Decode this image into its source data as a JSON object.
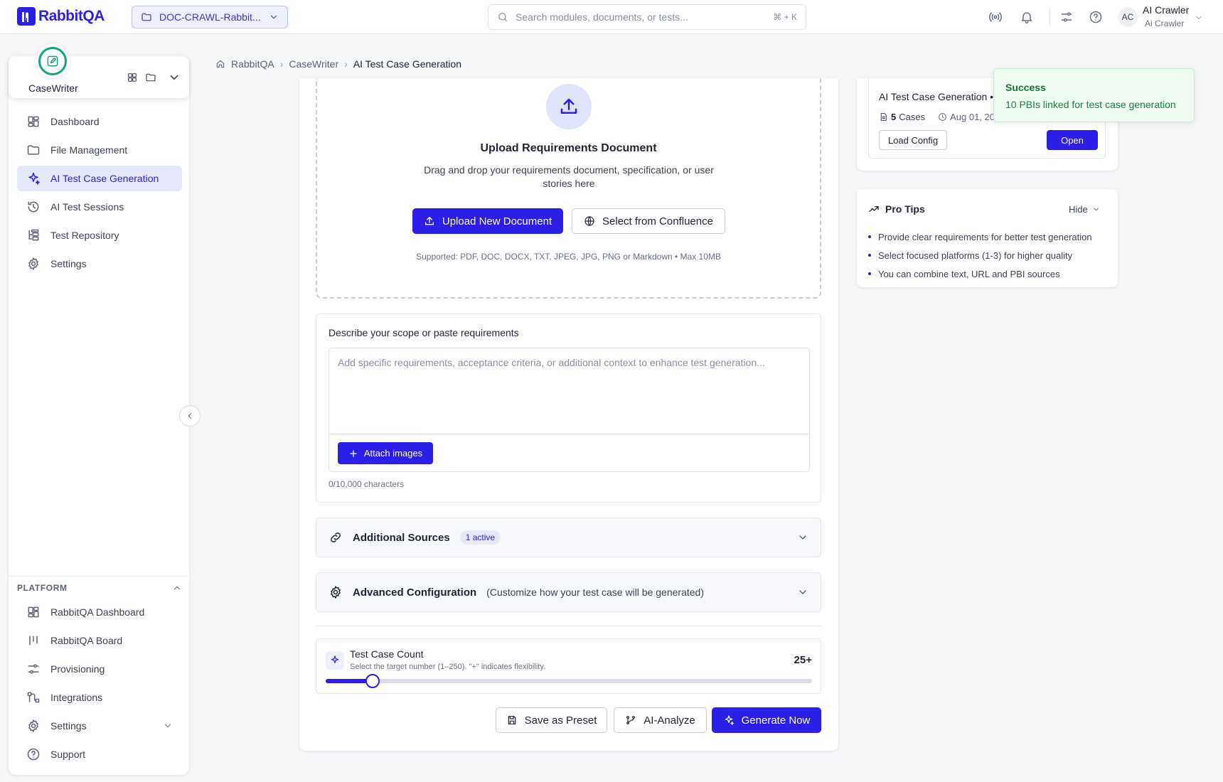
{
  "brand": {
    "name": "RabbitQA",
    "accent": "#2b1ee6",
    "success": "#16733a"
  },
  "header": {
    "project": "DOC-CRAWL-Rabbit...",
    "search_placeholder": "Search modules, documents, or tests...",
    "search_shortcut": "⌘ + K",
    "user_initials": "AC",
    "user_name": "AI Crawler",
    "user_sub": "Ai Crawler"
  },
  "module": {
    "name": "CaseWriter"
  },
  "sidebar": {
    "items": [
      {
        "label": "Dashboard",
        "icon": "grid-icon"
      },
      {
        "label": "File Management",
        "icon": "folder-icon"
      },
      {
        "label": "AI Test Case Generation",
        "icon": "sparkle-icon",
        "active": true
      },
      {
        "label": "AI Test Sessions",
        "icon": "history-icon"
      },
      {
        "label": "Test Repository",
        "icon": "tree-icon"
      },
      {
        "label": "Settings",
        "icon": "gear-icon"
      }
    ],
    "platform_heading": "PLATFORM",
    "platform_items": [
      {
        "label": "RabbitQA Dashboard",
        "icon": "grid-icon"
      },
      {
        "label": "RabbitQA Board",
        "icon": "board-icon"
      },
      {
        "label": "Provisioning",
        "icon": "sliders-icon"
      },
      {
        "label": "Integrations",
        "icon": "integrations-icon"
      },
      {
        "label": "Settings",
        "icon": "gear-icon"
      },
      {
        "label": "Support",
        "icon": "help-icon"
      }
    ]
  },
  "breadcrumb": {
    "home": "RabbitQA",
    "section": "CaseWriter",
    "current": "AI Test Case Generation"
  },
  "upload": {
    "title": "Upload Requirements Document",
    "description": "Drag and drop your requirements document, specification, or user stories here",
    "upload_button": "Upload New Document",
    "confluence_button": "Select from Confluence",
    "supported": "Supported: PDF, DOC, DOCX, TXT, JPEG, JPG, PNG or Markdown • Max 10MB"
  },
  "scope": {
    "label": "Describe your scope or paste requirements",
    "placeholder": "Add specific requirements, acceptance criteria, or additional context to enhance test generation...",
    "attach_button": "Attach images",
    "char_count": "0/10,000 characters"
  },
  "additional_sources": {
    "title": "Additional Sources",
    "badge": "1 active"
  },
  "advanced": {
    "title": "Advanced Configuration",
    "subtitle": "(Customize how your test case will be generated)"
  },
  "test_count": {
    "title": "Test Case Count",
    "subtitle": "Select the target number (1–250). \"+\" indicates flexibility.",
    "value_label": "25+",
    "value": 25,
    "min": 1,
    "max": 250
  },
  "actions": {
    "save_preset": "Save as Preset",
    "analyze": "AI-Analyze",
    "generate": "Generate Now"
  },
  "recent": {
    "title": "AI Test Case Generation •",
    "cases_count": "5",
    "cases_label": "Cases",
    "date": "Aug 01, 202",
    "load_button": "Load Config",
    "open_button": "Open"
  },
  "toast": {
    "title": "Success",
    "message": "10 PBIs linked for test case generation"
  },
  "tips": {
    "title": "Pro Tips",
    "hide": "Hide",
    "items": [
      "Provide clear requirements for better test generation",
      "Select focused platforms (1-3) for higher quality",
      "You can combine text, URL and PBI sources"
    ]
  }
}
